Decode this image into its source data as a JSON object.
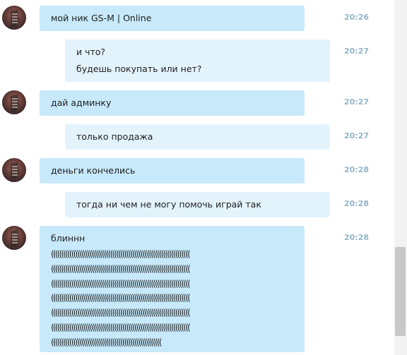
{
  "messages": [
    {
      "type": "in",
      "lines": [
        "мой ник GS-M | Online"
      ],
      "time": "20:26"
    },
    {
      "type": "out",
      "lines": [
        "и что?",
        "будешь покупать или нет?"
      ],
      "time": "20:27"
    },
    {
      "type": "in",
      "lines": [
        "дай админку"
      ],
      "time": "20:27"
    },
    {
      "type": "out",
      "lines": [
        "только продажа"
      ],
      "time": "20:27"
    },
    {
      "type": "in",
      "lines": [
        "деньги кончелись"
      ],
      "time": "20:28"
    },
    {
      "type": "out",
      "lines": [
        "тогда ни чем не могу помочь играй так"
      ],
      "time": "20:28"
    },
    {
      "type": "in",
      "lines": [
        "блиннн"
      ],
      "time": "20:28",
      "paren_lines": [
        "((((((((((((((((((((((((((((((((((((((((((((((((((((((((((((((((((((",
        "((((((((((((((((((((((((((((((((((((((((((((((((((((((((((((((((((((",
        "((((((((((((((((((((((((((((((((((((((((((((((((((((((((((((((((((((",
        "((((((((((((((((((((((((((((((((((((((((((((((((((((((((((((((((((((",
        "((((((((((((((((((((((((((((((((((((((((((((((((((((((((((((((((((((",
        "((((((((((((((((((((((((((((((((((((((((((((((((((((((((((((((((((((",
        "(((((((((((((((((((((((((((((((((((((((((((((((((((((("
      ]
    }
  ],
  "avatar_icon": "user-avatar-icon"
}
